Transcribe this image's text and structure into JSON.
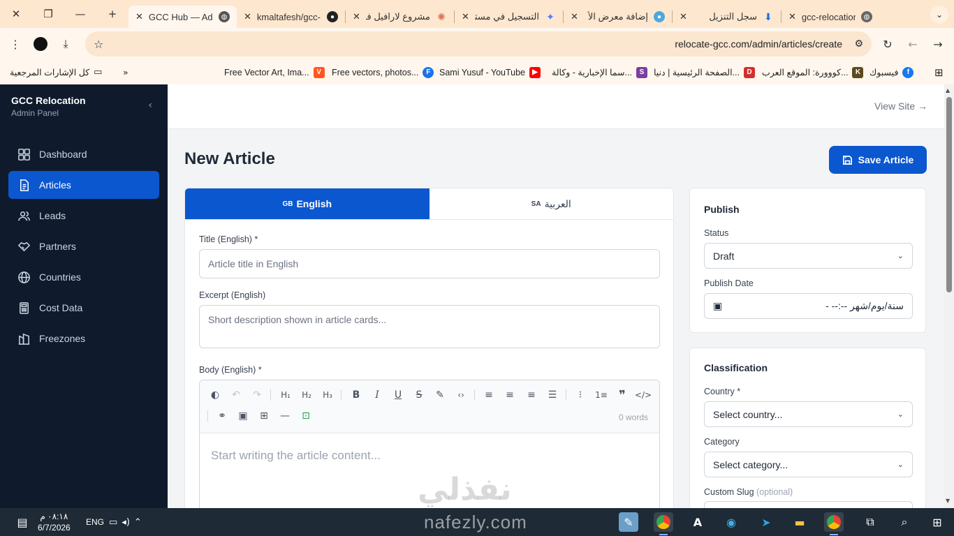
{
  "browser": {
    "tabs": [
      {
        "title": "GCC Hub — Admin",
        "icon": "globe-icon",
        "active": true
      },
      {
        "title": "kmaltafesh/gcc-",
        "icon": "github-icon"
      },
      {
        "title": "مشروع لارافيل فر",
        "icon": "claude-icon"
      },
      {
        "title": "التسجيل في مستـ",
        "icon": "gemini-icon"
      },
      {
        "title": "إضافة معرض الأ",
        "icon": "chrome-app-icon"
      },
      {
        "title": "سجل التنزيل",
        "icon": "download-icon"
      },
      {
        "title": "gcc-relocation-h",
        "icon": "globe-icon"
      }
    ],
    "url": "relocate-gcc.com/admin/articles/create",
    "bookmarks": [
      {
        "label": "كل الإشارات المرجعية"
      },
      {
        "label": "Free Vector Art, Ima...",
        "color": "#ff5722",
        "glyph": "V"
      },
      {
        "label": "Free vectors, photos...",
        "color": "#1a73e8",
        "glyph": "F"
      },
      {
        "label": "Sami Yusuf - YouTube",
        "color": "#ff0000",
        "glyph": "▶"
      },
      {
        "label": "سما الإخبارية - وكالة...",
        "color": "#7b3fa0",
        "glyph": "S"
      },
      {
        "label": "الصفحة الرئيسية | دنيا...",
        "color": "#d32f2f",
        "glyph": "D"
      },
      {
        "label": "كووورة: الموقع العرب...",
        "color": "#5d4a1f",
        "glyph": "K"
      },
      {
        "label": "فيسبوك",
        "color": "#1877f2",
        "glyph": "f"
      }
    ]
  },
  "sidebar": {
    "brand": "GCC Relocation",
    "subtitle": "Admin Panel",
    "items": [
      {
        "label": "Dashboard",
        "icon": "dashboard-icon"
      },
      {
        "label": "Articles",
        "icon": "articles-icon",
        "active": true
      },
      {
        "label": "Leads",
        "icon": "leads-icon"
      },
      {
        "label": "Partners",
        "icon": "partners-icon"
      },
      {
        "label": "Countries",
        "icon": "globe-icon"
      },
      {
        "label": "Cost Data",
        "icon": "calculator-icon"
      },
      {
        "label": "Freezones",
        "icon": "building-icon"
      }
    ]
  },
  "header": {
    "view_site": "View Site →"
  },
  "page": {
    "title": "New Article",
    "save_label": "Save Article",
    "lang_tabs": [
      {
        "code": "GB",
        "label": "English",
        "active": true
      },
      {
        "code": "SA",
        "label": "العربية"
      }
    ],
    "fields": {
      "title_label": "Title (English) *",
      "title_placeholder": "Article title in English",
      "excerpt_label": "Excerpt (English)",
      "excerpt_placeholder": "Short description shown in article cards...",
      "body_label": "Body (English) *",
      "body_placeholder": "Start writing the article content...",
      "word_count": "0 words"
    },
    "watermark": "نفذلي"
  },
  "publish": {
    "title": "Publish",
    "status_label": "Status",
    "status_value": "Draft",
    "date_label": "Publish Date",
    "date_value": "سنة/يوم/شهر --:-- -"
  },
  "classification": {
    "title": "Classification",
    "country_label": "Country *",
    "country_value": "Select country...",
    "category_label": "Category",
    "category_value": "Select category...",
    "slug_label": "Custom Slug",
    "slug_optional": "(optional)"
  },
  "taskbar": {
    "time": "٠٨:١٨ م",
    "date": "6/7/2026",
    "lang": "ENG",
    "watermark_site": "nafezly.com"
  }
}
